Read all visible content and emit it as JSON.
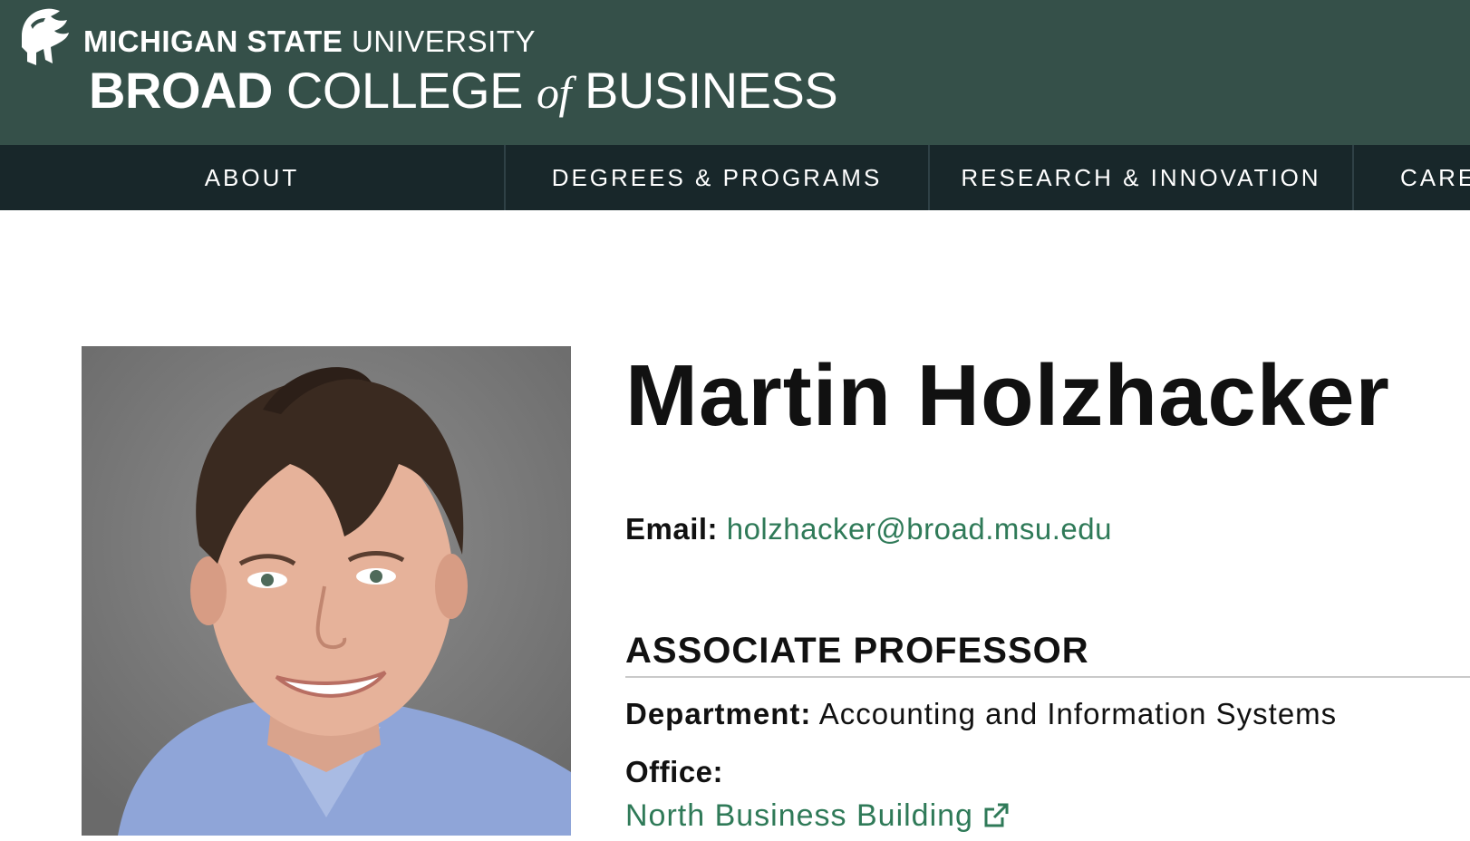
{
  "header": {
    "university_bold": "MICHIGAN STATE",
    "university_light": "UNIVERSITY",
    "college_bold": "BROAD",
    "college_light": "COLLEGE",
    "college_of": "of",
    "college_business": "BUSINESS",
    "logo_icon": "spartan-helmet-icon",
    "brand_color": "#355049"
  },
  "nav": {
    "items": [
      {
        "label": "ABOUT"
      },
      {
        "label": "DEGREES & PROGRAMS"
      },
      {
        "label": "RESEARCH & INNOVATION"
      },
      {
        "label": "CARE"
      }
    ],
    "background": "#18272a"
  },
  "profile": {
    "name": "Martin Holzhacker",
    "email_label": "Email:",
    "email": "holzhacker@broad.msu.edu",
    "title": "ASSOCIATE PROFESSOR",
    "department_label": "Department:",
    "department": "Accounting and Information Systems",
    "office_label": "Office:",
    "office": "North Business Building",
    "office_link_icon": "external-link-icon",
    "link_color": "#2f7a58"
  }
}
